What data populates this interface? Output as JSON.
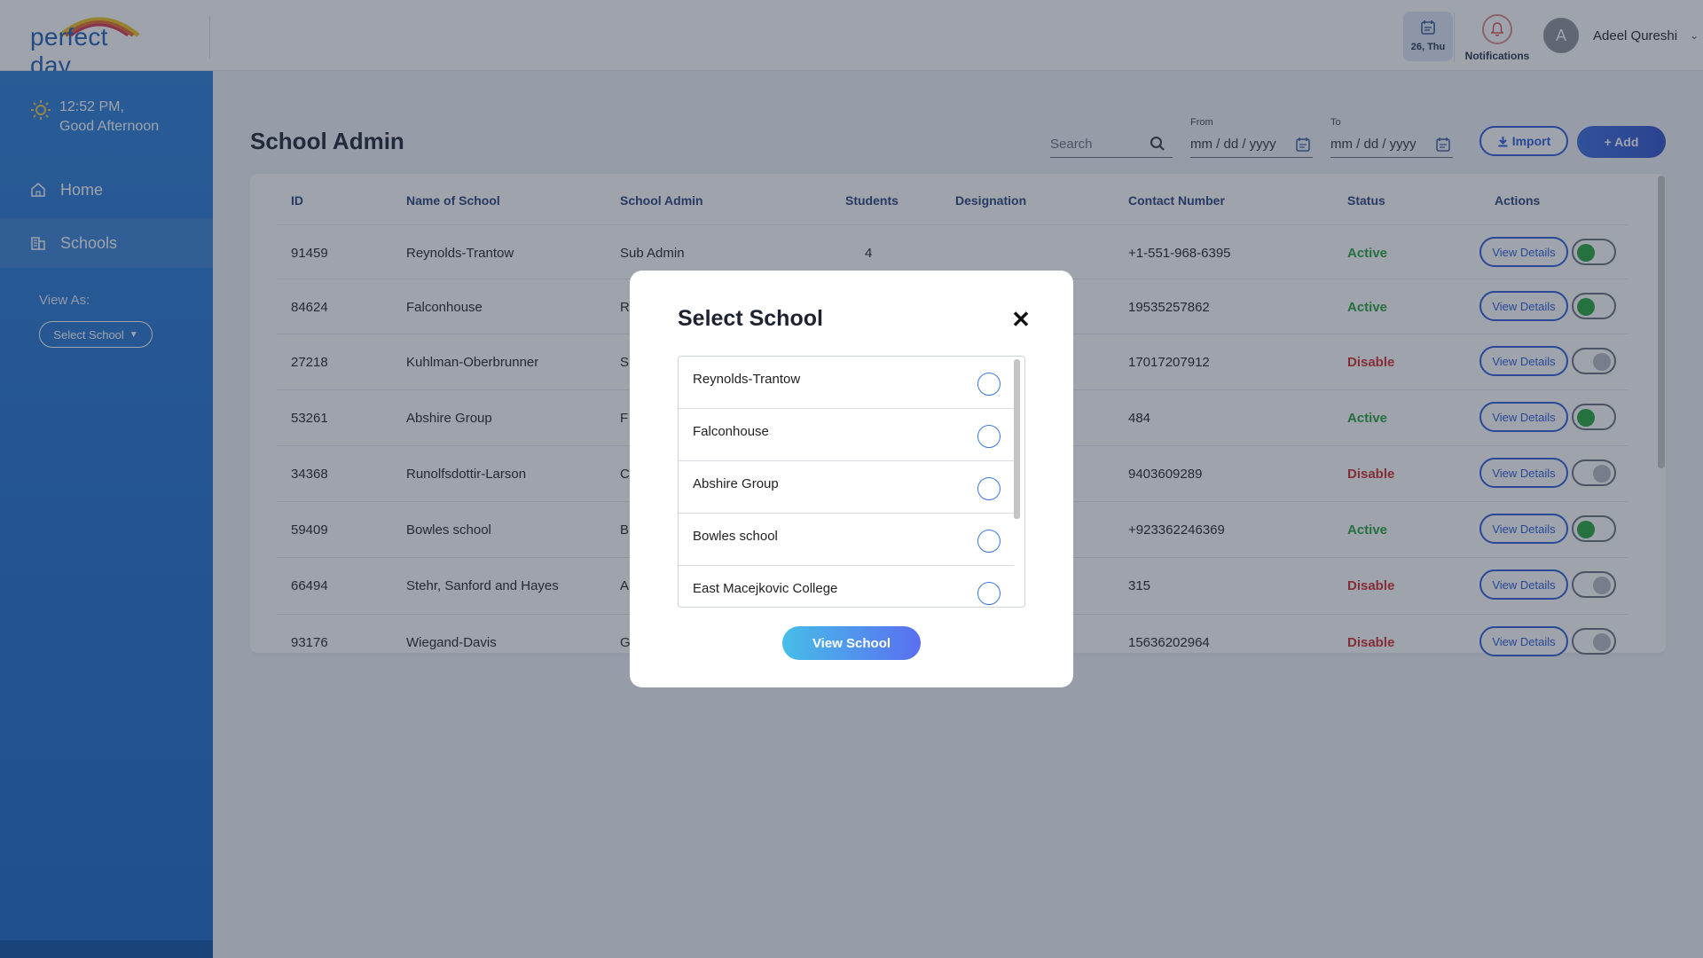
{
  "header": {
    "logo_text": "perfect day",
    "date_label": "26, Thu",
    "notifications_label": "Notifications",
    "avatar_initial": "A",
    "user_name": "Adeel Qureshi"
  },
  "sidebar": {
    "time": "12:52 PM,",
    "greeting": "Good Afternoon",
    "items": [
      {
        "label": "Home"
      },
      {
        "label": "Schools"
      }
    ],
    "view_as_label": "View As:",
    "select_school_label": "Select School"
  },
  "main": {
    "title": "School Admin",
    "search_placeholder": "Search",
    "from_label": "From",
    "to_label": "To",
    "date_placeholder": "mm / dd / yyyy",
    "import_label": "Import",
    "add_label": "+ Add",
    "view_details_label": "View Details",
    "columns": [
      "ID",
      "Name of School",
      "School Admin",
      "Students",
      "Designation",
      "Contact Number",
      "Status",
      "Actions"
    ],
    "rows": [
      {
        "id": "91459",
        "name": "Reynolds-Trantow",
        "admin": "Sub Admin",
        "students": "4",
        "designation": "",
        "contact": "+1-551-968-6395",
        "status": "Active",
        "toggle_on": true
      },
      {
        "id": "84624",
        "name": "Falconhouse",
        "admin": "R",
        "students": "",
        "designation": "",
        "contact": "19535257862",
        "status": "Active",
        "toggle_on": true
      },
      {
        "id": "27218",
        "name": "Kuhlman-Oberbrunner",
        "admin": "S",
        "students": "",
        "designation": "",
        "contact": "17017207912",
        "status": "Disable",
        "toggle_on": false
      },
      {
        "id": "53261",
        "name": "Abshire Group",
        "admin": "F",
        "students": "",
        "designation": "",
        "contact": "484",
        "status": "Active",
        "toggle_on": true
      },
      {
        "id": "34368",
        "name": "Runolfsdottir-Larson",
        "admin": "C",
        "students": "",
        "designation": "",
        "contact": "9403609289",
        "status": "Disable",
        "toggle_on": false
      },
      {
        "id": "59409",
        "name": "Bowles school",
        "admin": "B",
        "students": "",
        "designation": "",
        "contact": "+923362246369",
        "status": "Active",
        "toggle_on": true
      },
      {
        "id": "66494",
        "name": "Stehr, Sanford and Hayes",
        "admin": "A",
        "students": "",
        "designation": "",
        "contact": "315",
        "status": "Disable",
        "toggle_on": false
      },
      {
        "id": "93176",
        "name": "Wiegand-Davis",
        "admin": "G",
        "students": "",
        "designation": "",
        "contact": "15636202964",
        "status": "Disable",
        "toggle_on": false
      }
    ]
  },
  "modal": {
    "title": "Select School",
    "close_symbol": "✕",
    "schools": [
      "Reynolds-Trantow",
      "Falconhouse",
      "Abshire Group",
      "Bowles school",
      "East Macejkovic College"
    ],
    "button_label": "View School"
  },
  "colors": {
    "accent": "#2a5bd7",
    "sidebar": "#1f6fcd",
    "active": "#25a03a",
    "disable": "#d22b2b"
  }
}
